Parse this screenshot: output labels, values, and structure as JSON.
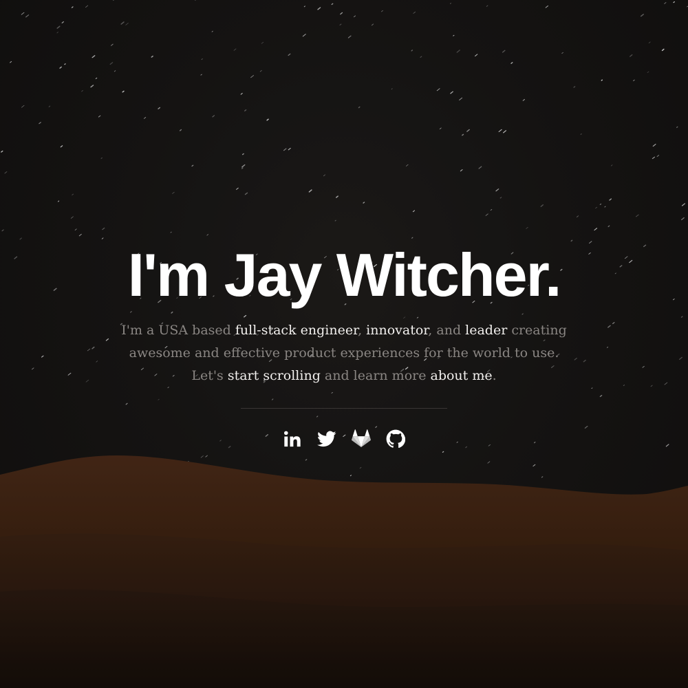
{
  "hero": {
    "headline": "I'm Jay Witcher.",
    "intro": {
      "t1": "I'm a USA based ",
      "role1": "full-stack engineer",
      "t2": ", ",
      "role2": "innovator",
      "t3": ", and ",
      "role3": "leader",
      "t4": " creating awesome and effective product experiences for the world to use. Let's ",
      "link_scroll": "start scrolling",
      "t5": " and learn more ",
      "link_about": "about me",
      "t6": "."
    }
  },
  "social": [
    {
      "name": "linkedin",
      "icon": "linkedin-icon"
    },
    {
      "name": "twitter",
      "icon": "twitter-icon"
    },
    {
      "name": "gitlab",
      "icon": "gitlab-icon"
    },
    {
      "name": "github",
      "icon": "github-icon"
    }
  ],
  "colors": {
    "headline": "#ffffff",
    "body_muted": "#8a8683",
    "body_highlight": "#f2f0ee",
    "background": "#141212",
    "dune": "#4a2a18"
  }
}
